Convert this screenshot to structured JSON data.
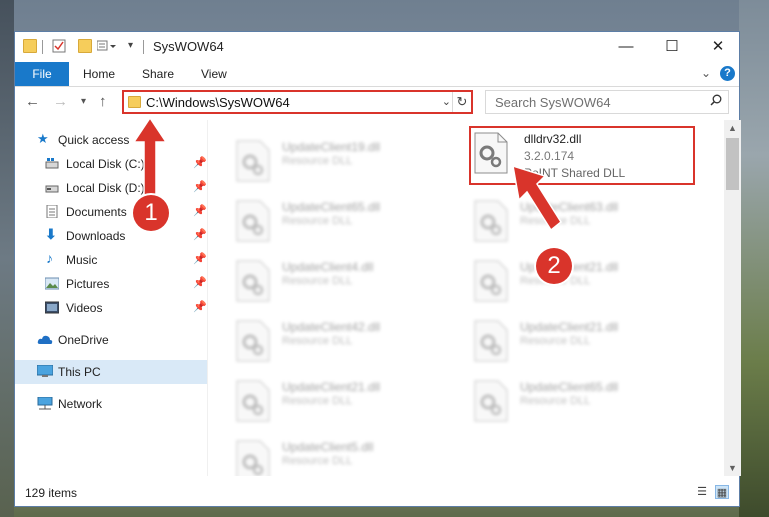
{
  "window": {
    "title": "SysWOW64",
    "controls": {
      "minimize": "—",
      "maximize": "☐",
      "close": "✕"
    }
  },
  "ribbon": {
    "tabs": [
      "File",
      "Home",
      "Share",
      "View"
    ]
  },
  "navigation": {
    "address": "C:\\Windows\\SysWOW64",
    "search_placeholder": "Search SysWOW64"
  },
  "sidebar": {
    "items": [
      {
        "label": "Quick access",
        "icon": "star-icon",
        "pinned": false
      },
      {
        "label": "Local Disk (C:)",
        "icon": "drive-c-icon",
        "pinned": true
      },
      {
        "label": "Local Disk (D:)",
        "icon": "drive-d-icon",
        "pinned": true
      },
      {
        "label": "Documents",
        "icon": "documents-icon",
        "pinned": true
      },
      {
        "label": "Downloads",
        "icon": "downloads-icon",
        "pinned": true
      },
      {
        "label": "Music",
        "icon": "music-icon",
        "pinned": true
      },
      {
        "label": "Pictures",
        "icon": "pictures-icon",
        "pinned": true
      },
      {
        "label": "Videos",
        "icon": "videos-icon",
        "pinned": true
      },
      {
        "label": "OneDrive",
        "icon": "onedrive-icon",
        "pinned": false
      },
      {
        "label": "This PC",
        "icon": "this-pc-icon",
        "pinned": false,
        "selected": true
      },
      {
        "label": "Network",
        "icon": "network-icon",
        "pinned": false
      }
    ]
  },
  "files": {
    "highlighted": {
      "name": "dlldrv32.dll",
      "version": "3.2.0.174",
      "description": "PoINT Shared DLL"
    },
    "left_column": [
      {
        "name": "UpdateClient19.dll",
        "type": "Resource DLL"
      },
      {
        "name": "UpdateClient65.dll",
        "type": "Resource DLL"
      },
      {
        "name": "UpdateClient4.dll",
        "type": "Resource DLL"
      },
      {
        "name": "UpdateClient42.dll",
        "type": "Resource DLL"
      },
      {
        "name": "UpdateClient21.dll",
        "type": "Resource DLL"
      },
      {
        "name": "UpdateClient5.dll",
        "type": "Resource DLL"
      }
    ],
    "right_column": [
      {
        "name": "UpdateClient63.dll",
        "type": "Resource DLL"
      },
      {
        "name": "UpdateClient21.dll",
        "type": "Resource DLL"
      },
      {
        "name": "UpdateClient21.dll",
        "type": "Resource DLL"
      },
      {
        "name": "UpdateClient65.dll",
        "type": "Resource DLL"
      }
    ]
  },
  "status": {
    "item_count": "129 items"
  },
  "annotations": {
    "badge1": "1",
    "badge2": "2",
    "color": "#d9342b"
  }
}
